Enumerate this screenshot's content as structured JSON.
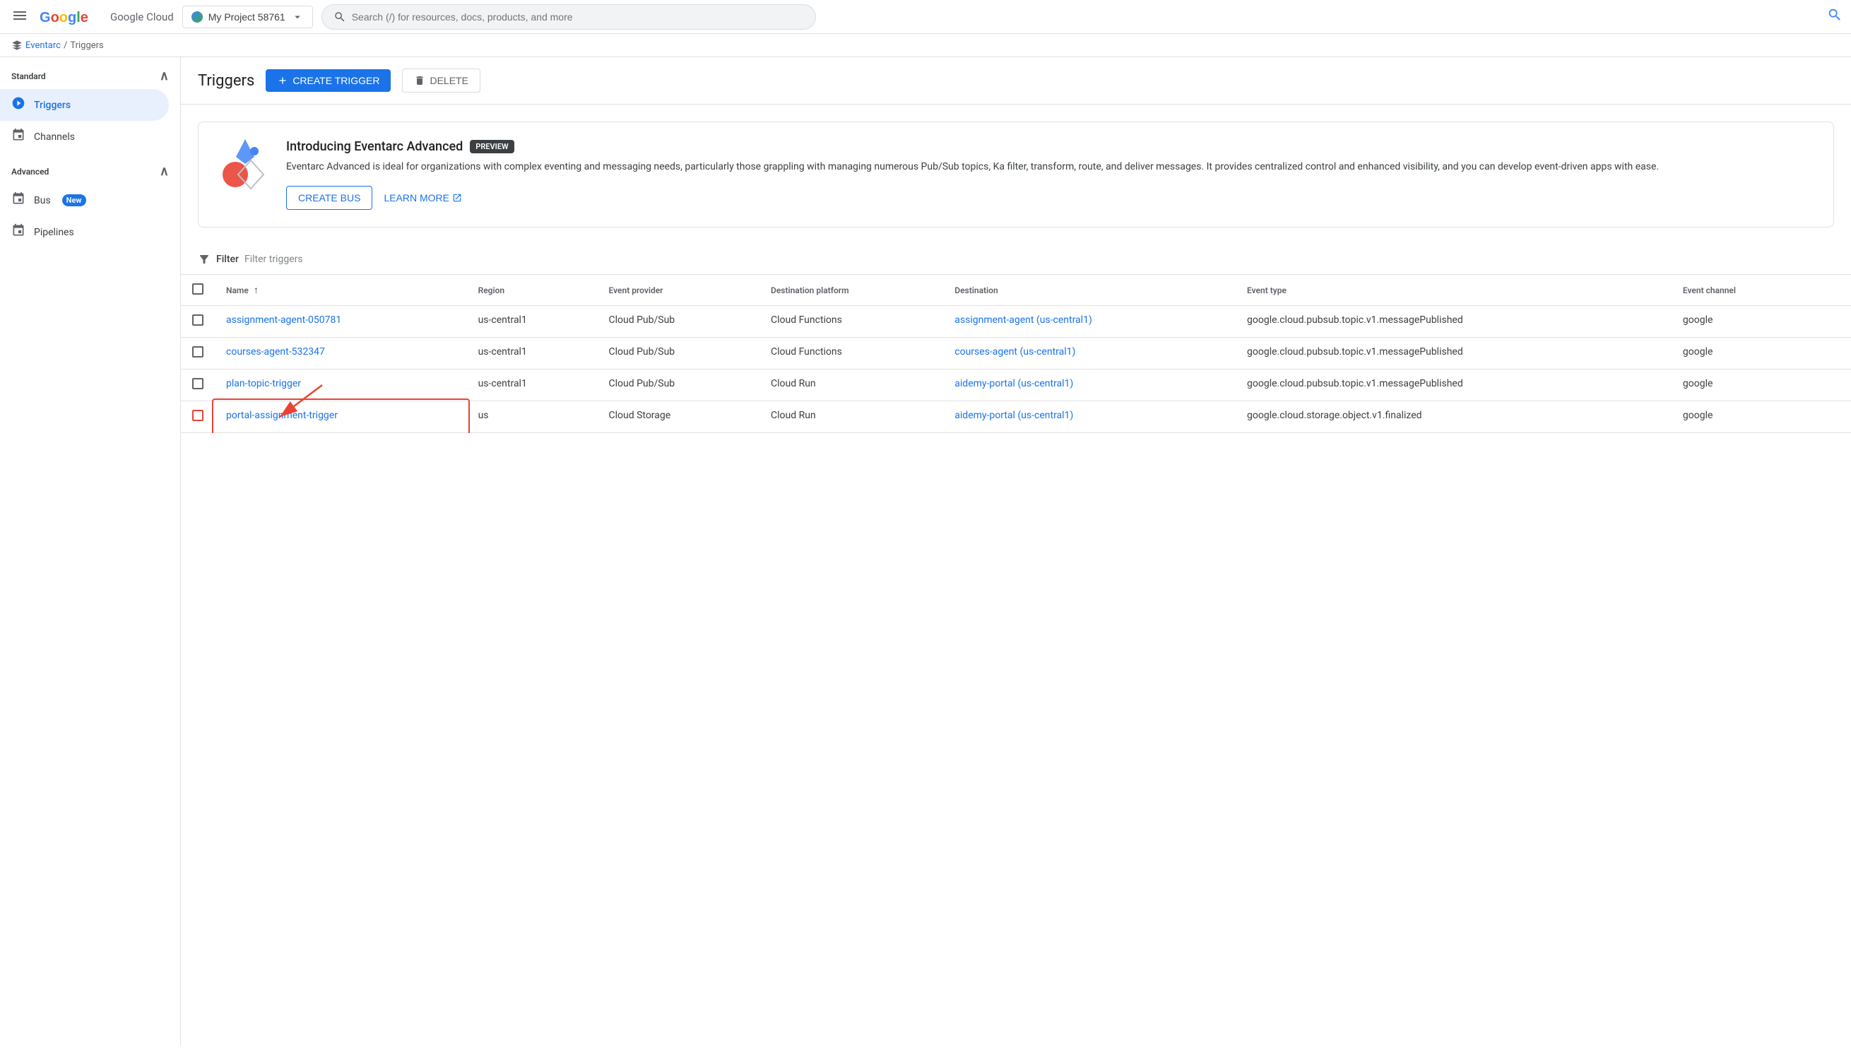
{
  "topbar": {
    "menu_icon": "☰",
    "logo_text": "Google Cloud",
    "project_btn_label": "My Project 58761",
    "search_placeholder": "Search (/) for resources, docs, products, and more"
  },
  "breadcrumb": {
    "parent": "Eventarc",
    "separator": "/",
    "current": "Triggers"
  },
  "sidebar": {
    "standard_label": "Standard",
    "advanced_label": "Advanced",
    "items": [
      {
        "id": "triggers",
        "label": "Triggers",
        "icon": "→",
        "active": true
      },
      {
        "id": "channels",
        "label": "Channels",
        "icon": "↗",
        "active": false
      },
      {
        "id": "bus",
        "label": "Bus",
        "icon": "⊕",
        "active": false,
        "badge": "New"
      },
      {
        "id": "pipelines",
        "label": "Pipelines",
        "icon": "↗",
        "active": false
      }
    ]
  },
  "page": {
    "title": "Triggers",
    "btn_create": "CREATE TRIGGER",
    "btn_delete": "DELETE"
  },
  "promo": {
    "title": "Introducing Eventarc Advanced",
    "badge": "PREVIEW",
    "description": "Eventarc Advanced is ideal for organizations with complex eventing and messaging needs, particularly those grappling with managing numerous Pub/Sub topics, Ka filter, transform, route, and deliver messages. It provides centralized control and enhanced visibility, and you can develop event-driven apps with ease.",
    "btn_create_bus": "CREATE BUS",
    "btn_learn_more": "LEARN MORE"
  },
  "filter": {
    "label": "Filter",
    "placeholder": "Filter triggers"
  },
  "table": {
    "columns": [
      "",
      "Name",
      "Region",
      "Event provider",
      "Destination platform",
      "Destination",
      "Event type",
      "Event channel",
      ""
    ],
    "rows": [
      {
        "name": "assignment-agent-050781",
        "name_href": "#",
        "region": "us-central1",
        "event_provider": "Cloud Pub/Sub",
        "destination_platform": "Cloud Functions",
        "destination": "assignment-agent (us-central1)",
        "destination_href": "#",
        "event_type": "google.cloud.pubsub.topic.v1.messagePublished",
        "event_channel": "google",
        "highlighted": false
      },
      {
        "name": "courses-agent-532347",
        "name_href": "#",
        "region": "us-central1",
        "event_provider": "Cloud Pub/Sub",
        "destination_platform": "Cloud Functions",
        "destination": "courses-agent (us-central1)",
        "destination_href": "#",
        "event_type": "google.cloud.pubsub.topic.v1.messagePublished",
        "event_channel": "google",
        "highlighted": false
      },
      {
        "name": "plan-topic-trigger",
        "name_href": "#",
        "region": "us-central1",
        "event_provider": "Cloud Pub/Sub",
        "destination_platform": "Cloud Run",
        "destination": "aidemy-portal (us-central1)",
        "destination_href": "#",
        "event_type": "google.cloud.pubsub.topic.v1.messagePublished",
        "event_channel": "google",
        "highlighted": false
      },
      {
        "name": "portal-assignment-trigger",
        "name_href": "#",
        "region": "us",
        "event_provider": "Cloud Storage",
        "destination_platform": "Cloud Run",
        "destination": "aidemy-portal (us-central1)",
        "destination_href": "#",
        "event_type": "google.cloud.storage.object.v1.finalized",
        "event_channel": "google",
        "highlighted": true
      }
    ]
  },
  "colors": {
    "blue": "#1a73e8",
    "red": "#ea4335",
    "green": "#34a853",
    "yellow": "#fbbc04",
    "active_bg": "#e8f0fe"
  }
}
